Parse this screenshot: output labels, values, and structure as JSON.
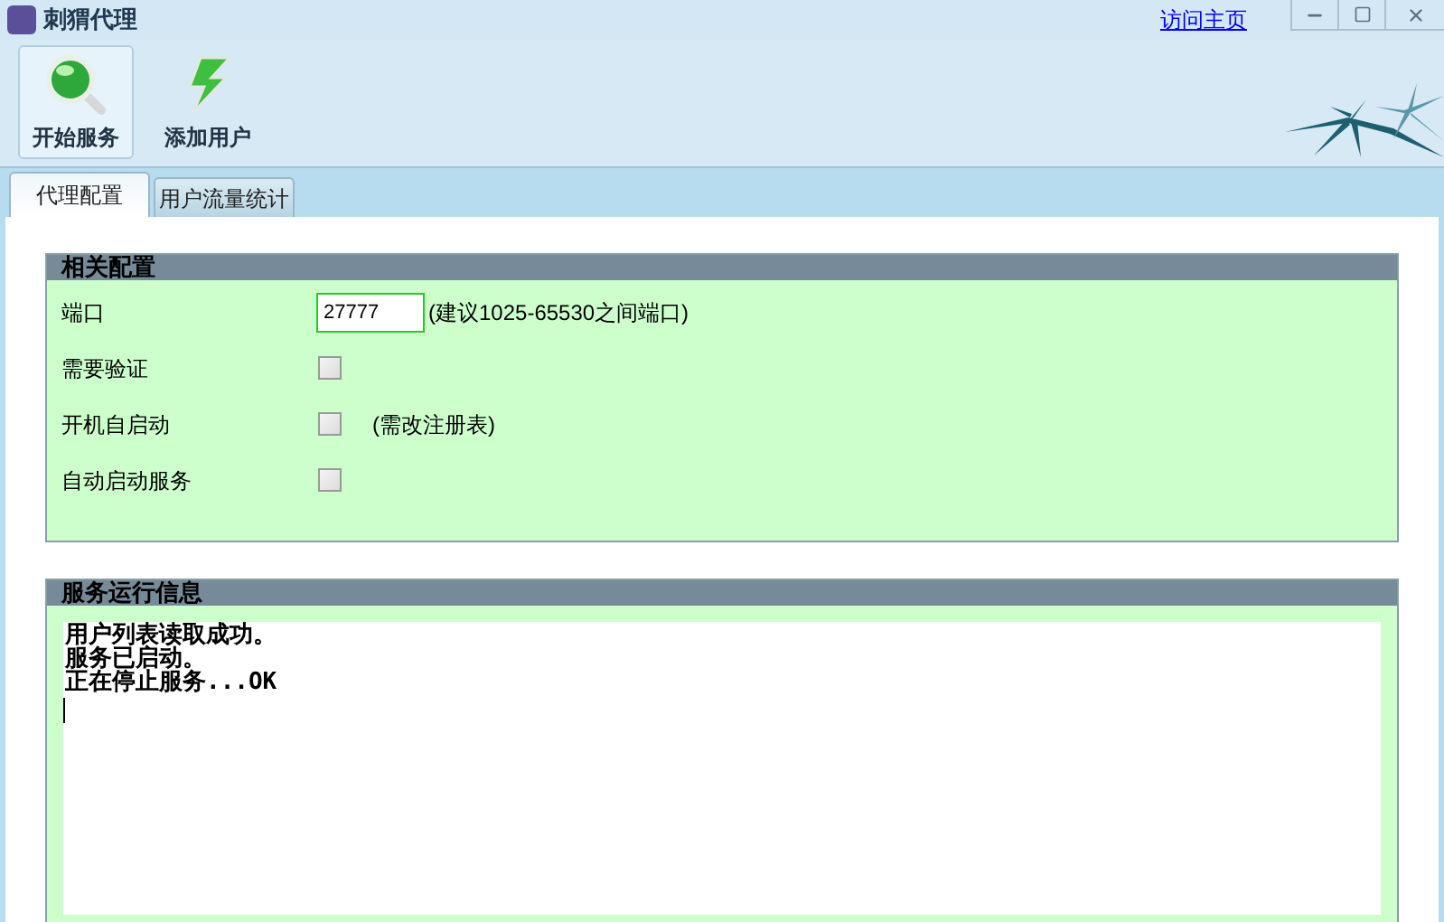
{
  "window": {
    "title": "刺猬代理",
    "link": "访问主页"
  },
  "toolbar": [
    {
      "label": "开始服务",
      "kind": "search",
      "selected": true
    },
    {
      "label": "添加用户",
      "kind": "bolt",
      "selected": false
    }
  ],
  "tabs": [
    {
      "label": "代理配置",
      "selected": true
    },
    {
      "label": "用户流量统计",
      "selected": false
    }
  ],
  "config": {
    "title": "相关配置",
    "rows": [
      {
        "kind": "input",
        "label": "端口",
        "value": "27777",
        "note": "(建议1025-65530之间端口)"
      },
      {
        "kind": "checkbox",
        "label": "需要验证",
        "checked": false
      },
      {
        "kind": "checkbox",
        "label": "开机自启动",
        "checked": false,
        "note": "(需改注册表)"
      },
      {
        "kind": "checkbox",
        "label": "自动启动服务",
        "checked": false
      }
    ]
  },
  "log": {
    "title": "服务运行信息",
    "lines": [
      "用户列表读取成功。",
      "服务已启动。",
      "正在停止服务...OK"
    ]
  }
}
